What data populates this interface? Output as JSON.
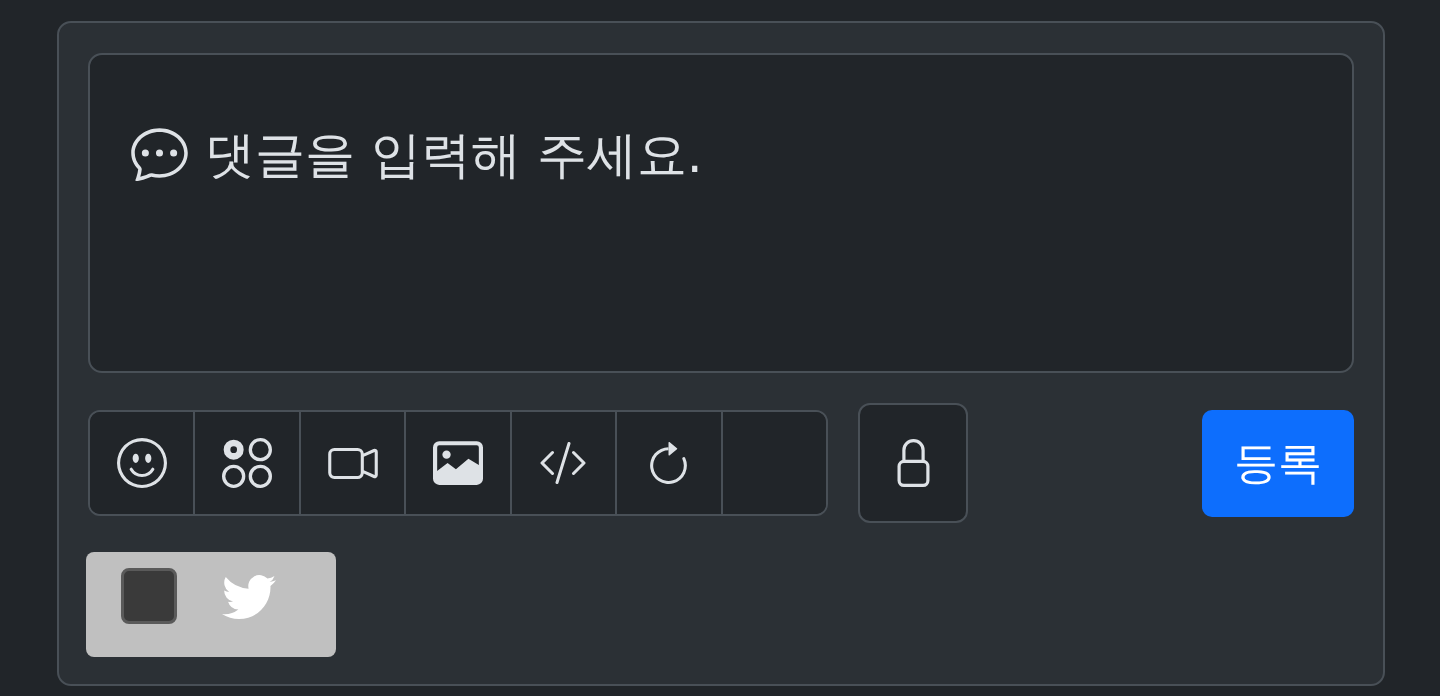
{
  "comment_field": {
    "placeholder": "댓글을 입력해 주세요."
  },
  "submit_button": {
    "label": "등록"
  },
  "share_option": {
    "checked": false
  }
}
